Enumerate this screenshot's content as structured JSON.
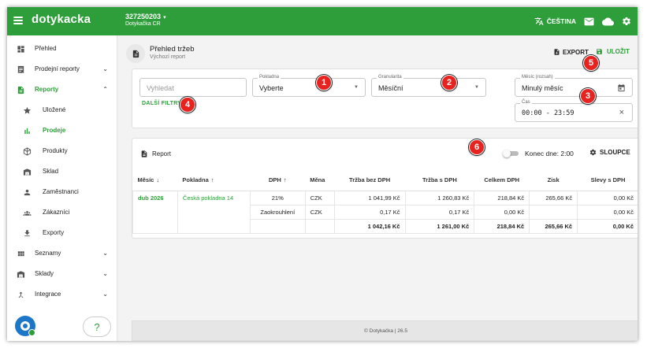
{
  "topbar": {
    "logo": "dotykacka",
    "company_id": "327250203",
    "company_caret": "▾",
    "company_name": "Dotykačka CR",
    "language": "ČEŠTINA"
  },
  "sidebar": {
    "items": [
      {
        "label": "Přehled",
        "icon": "dashboard-icon"
      },
      {
        "label": "Prodejní reporty",
        "icon": "receipt-icon"
      },
      {
        "label": "Reporty",
        "icon": "report-icon"
      },
      {
        "label": "Uložené",
        "icon": "star-icon"
      },
      {
        "label": "Prodeje",
        "icon": "bar-chart-icon"
      },
      {
        "label": "Produkty",
        "icon": "box-icon"
      },
      {
        "label": "Sklad",
        "icon": "warehouse-icon"
      },
      {
        "label": "Zaměstnanci",
        "icon": "person-icon"
      },
      {
        "label": "Zákazníci",
        "icon": "people-icon"
      },
      {
        "label": "Exporty",
        "icon": "download-icon"
      },
      {
        "label": "Seznamy",
        "icon": "grid-icon"
      },
      {
        "label": "Sklady",
        "icon": "warehouse-icon"
      },
      {
        "label": "Integrace",
        "icon": "merge-icon"
      }
    ],
    "help_label": "?"
  },
  "header": {
    "title": "Přehled tržeb",
    "subtitle": "Výchozí report",
    "export_label": "EXPORT",
    "save_label": "ULOŽIT"
  },
  "filters": {
    "search_placeholder": "Vyhledat",
    "register_label": "Pokladna",
    "register_value": "Vyberte",
    "granularity_label": "Granularita",
    "granularity_value": "Měsíční",
    "month_label": "Měsíc (rozsah)",
    "month_value": "Minulý měsíc",
    "time_label": "Čas",
    "time_value": "00:00 - 23:59",
    "more_filters": "DALŠÍ FILTRY"
  },
  "report": {
    "title": "Report",
    "toggle_label": "Konec dne: 2:00",
    "columns_button": "SLOUPCE",
    "columns": [
      "Měsíc",
      "Pokladna",
      "DPH",
      "Měna",
      "Tržba bez DPH",
      "Tržba s DPH",
      "Celkem DPH",
      "Zisk",
      "Slevy s DPH"
    ],
    "rows": [
      {
        "month": "dub 2026",
        "register": "Česká pokladna 14",
        "vat": "21%",
        "currency": "CZK",
        "net": "1 041,99 Kč",
        "gross": "1 260,83 Kč",
        "vat_total": "218,84 Kč",
        "profit": "265,66 Kč",
        "discount": "0,00 Kč"
      },
      {
        "month": "",
        "register": "",
        "vat": "Zaokrouhlení",
        "currency": "CZK",
        "net": "0,17 Kč",
        "gross": "0,17 Kč",
        "vat_total": "0,00 Kč",
        "profit": "",
        "discount": "0,00 Kč"
      }
    ],
    "total": {
      "net": "1 042,16 Kč",
      "gross": "1 261,00 Kč",
      "vat_total": "218,84 Kč",
      "profit": "265,66 Kč",
      "discount": "0,00 Kč"
    }
  },
  "footer": {
    "text": "© Dotykačka  | 26.5"
  },
  "badges": [
    "1",
    "2",
    "3",
    "4",
    "5",
    "6"
  ],
  "colors": {
    "brand_green": "#2e9e3a",
    "badge_red": "#e8231f"
  }
}
